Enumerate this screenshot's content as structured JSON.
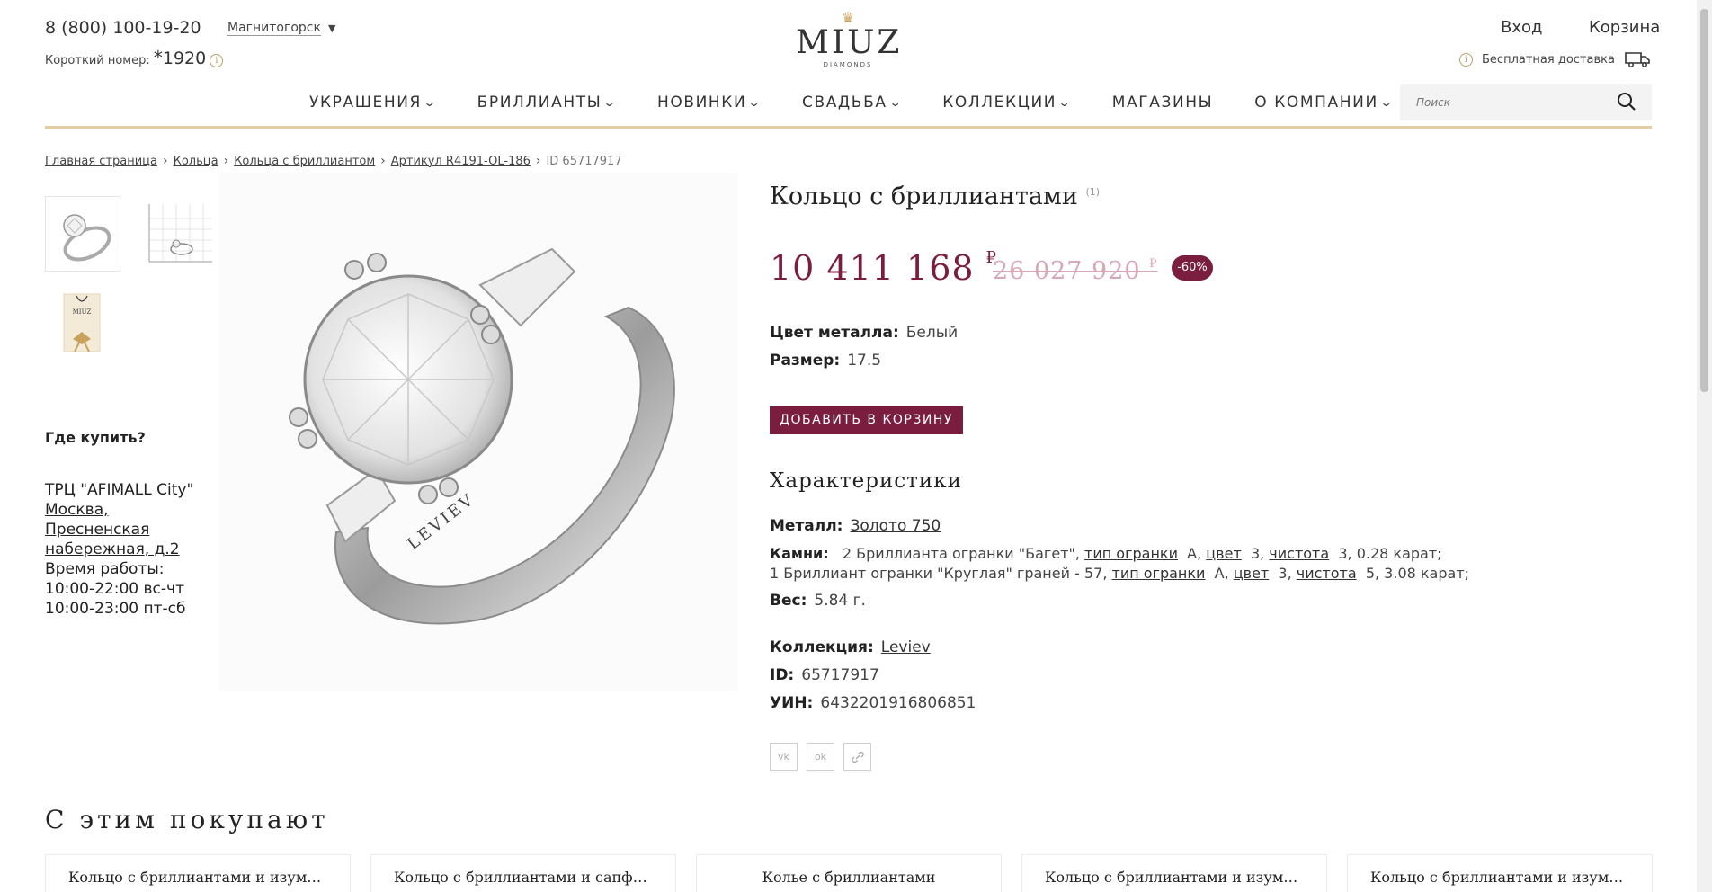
{
  "header": {
    "phone": "8 (800) 100-19-20",
    "short_label": "Короткий номер:",
    "short_star": "*",
    "short_number": "1920",
    "city": "Магнитогорск",
    "logo_word": "MIUZ",
    "logo_sub": "DIAMONDS",
    "login": "Вход",
    "cart": "Корзина",
    "delivery": "Бесплатная доставка",
    "info_glyph": "i"
  },
  "nav": {
    "items": [
      {
        "label": "УКРАШЕНИЯ",
        "dropdown": true
      },
      {
        "label": "БРИЛЛИАНТЫ",
        "dropdown": true
      },
      {
        "label": "НОВИНКИ",
        "dropdown": true
      },
      {
        "label": "СВАДЬБА",
        "dropdown": true
      },
      {
        "label": "КОЛЛЕКЦИИ",
        "dropdown": true
      },
      {
        "label": "МАГАЗИНЫ",
        "dropdown": false
      },
      {
        "label": "О КОМПАНИИ",
        "dropdown": true
      }
    ],
    "search_placeholder": "Поиск"
  },
  "breadcrumbs": {
    "items": [
      "Главная страница",
      "Кольца",
      "Кольца с бриллиантом",
      "Артикул R4191-OL-186"
    ],
    "current": "ID 65717917"
  },
  "sidebar": {
    "where_title": "Где купить?",
    "store_name": "ТРЦ \"AFIMALL City\"",
    "store_address": "Москва, Пресненская набережная, д.2",
    "hours_label": "Время работы:",
    "hours": [
      "10:00-22:00 вс-чт",
      "10:00-23:00 пт-сб"
    ],
    "ring_engraving": "LEVIEV",
    "box_logo": "MIUZ"
  },
  "product": {
    "title": "Кольцо с бриллиантами",
    "title_sup": "(1)",
    "price": "10 411 168",
    "old_price": "26 027 920",
    "currency": "₽",
    "discount": "-60%",
    "metal_color_label": "Цвет металла:",
    "metal_color": "Белый",
    "size_label": "Размер:",
    "size": "17.5",
    "add_to_cart": "ДОБАВИТЬ В КОРЗИНУ",
    "char_title": "Характеристики",
    "metal_label": "Металл:",
    "metal": "Золото 750",
    "stones_label": "Камни:",
    "stones_line1_pre": "2 Бриллианта огранки \"Багет\",",
    "stones_line2_pre": "1 Бриллиант огранки \"Круглая\" граней - 57,",
    "cut_type": "тип огранки",
    "color": "цвет",
    "clarity": "чистота",
    "s1_cut": "A,",
    "s1_color": "3,",
    "s1_clarity": "3, 0.28 карат;",
    "s2_cut": "A,",
    "s2_color": "3,",
    "s2_clarity": "5, 3.08 карат;",
    "weight_label": "Вес:",
    "weight": "5.84 г.",
    "collection_label": "Коллекция:",
    "collection": "Leviev",
    "id_label": "ID:",
    "id": "65717917",
    "uin_label": "УИН:",
    "uin": "6432201916806851",
    "share": [
      "vk",
      "ok",
      "link"
    ]
  },
  "also": {
    "title": "С этим покупают",
    "cards": [
      "Кольцо с бриллиантами и изумрудо...",
      "Кольцо с бриллиантами и сапфиром",
      "Колье с бриллиантами",
      "Кольцо с бриллиантами и изумрудо...",
      "Кольцо с бриллиантами и изумрудо..."
    ]
  },
  "colors": {
    "accent": "#7a1d3f",
    "gold": "#e3cfa3"
  }
}
